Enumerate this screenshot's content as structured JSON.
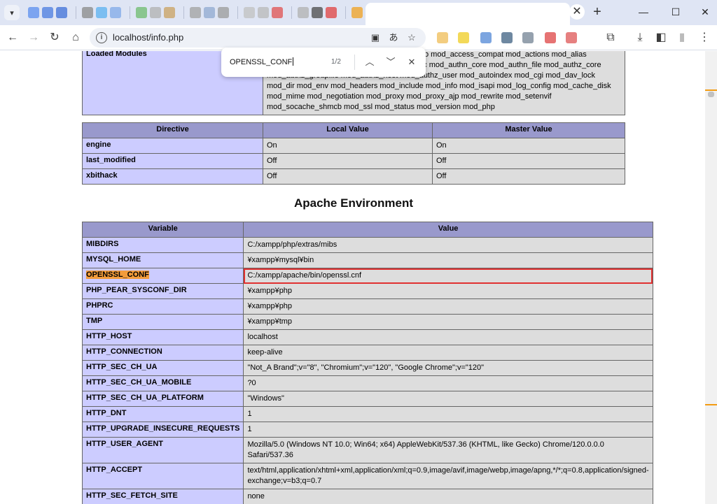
{
  "browser": {
    "tab_colors": [
      "#5b8def",
      "#4a7be0",
      "#3d6fd8",
      "#888888",
      "#5ab0f0",
      "#7fa8e8",
      "#6dbb6d",
      "#b0b0b0",
      "#c9a060",
      "#a0a0a0",
      "#8fa8d0",
      "#999999",
      "#c0c0c0",
      "#b8b8b8",
      "#e05050",
      "#b0b0b0",
      "#4a4a4a",
      "#e04040",
      "#f0a020",
      "#f0c030",
      "#e06060",
      "#e080a0",
      "#f0a0b0"
    ],
    "url": "localhost/info.php",
    "extension_colors": [
      "#f0c060",
      "#f0d030",
      "#5b8fd8",
      "#4a6a8a",
      "#7a8a9a",
      "#e05050",
      "#e06060"
    ]
  },
  "find": {
    "query": "OPENSSL_CONF",
    "count": "1/2"
  },
  "modules": {
    "label": "Loaded Modules",
    "lines": [
      "core mod_win32 mpm_winnt http_core mod_so mod_access_compat mod_actions mod_alias",
      "mod_allowmethods mod_asis mod_auth_basic mod_authn_core mod_authn_file mod_authz_core",
      "mod_authz_groupfile mod_authz_host mod_authz_user mod_autoindex mod_cgi mod_dav_lock",
      "mod_dir mod_env mod_headers mod_include mod_info mod_isapi mod_log_config mod_cache_disk",
      "mod_mime mod_negotiation mod_proxy mod_proxy_ajp mod_rewrite mod_setenvif",
      "mod_socache_shmcb mod_ssl mod_status mod_version mod_php"
    ]
  },
  "directives": {
    "headers": [
      "Directive",
      "Local Value",
      "Master Value"
    ],
    "rows": [
      {
        "name": "engine",
        "local": "On",
        "master": "On"
      },
      {
        "name": "last_modified",
        "local": "Off",
        "master": "Off"
      },
      {
        "name": "xbithack",
        "local": "Off",
        "master": "Off"
      }
    ]
  },
  "env_title": "Apache Environment",
  "env": {
    "headers": [
      "Variable",
      "Value"
    ],
    "rows": [
      {
        "name": "MIBDIRS",
        "value": "C:/xampp/php/extras/mibs"
      },
      {
        "name": "MYSQL_HOME",
        "value": "¥xampp¥mysql¥bin"
      },
      {
        "name": "OPENSSL_CONF",
        "value": "C:/xampp/apache/bin/openssl.cnf",
        "highlight": true
      },
      {
        "name": "PHP_PEAR_SYSCONF_DIR",
        "value": "¥xampp¥php"
      },
      {
        "name": "PHPRC",
        "value": "¥xampp¥php"
      },
      {
        "name": "TMP",
        "value": "¥xampp¥tmp"
      },
      {
        "name": "HTTP_HOST",
        "value": "localhost"
      },
      {
        "name": "HTTP_CONNECTION",
        "value": "keep-alive"
      },
      {
        "name": "HTTP_SEC_CH_UA",
        "value": "\"Not_A Brand\";v=\"8\", \"Chromium\";v=\"120\", \"Google Chrome\";v=\"120\""
      },
      {
        "name": "HTTP_SEC_CH_UA_MOBILE",
        "value": "?0"
      },
      {
        "name": "HTTP_SEC_CH_UA_PLATFORM",
        "value": "\"Windows\""
      },
      {
        "name": "HTTP_DNT",
        "value": "1"
      },
      {
        "name": "HTTP_UPGRADE_INSECURE_REQUESTS",
        "value": "1"
      },
      {
        "name": "HTTP_USER_AGENT",
        "value": "Mozilla/5.0 (Windows NT 10.0; Win64; x64) AppleWebKit/537.36 (KHTML, like Gecko) Chrome/120.0.0.0 Safari/537.36"
      },
      {
        "name": "HTTP_ACCEPT",
        "value": "text/html,application/xhtml+xml,application/xml;q=0.9,image/avif,image/webp,image/apng,*/*;q=0.8,application/signed-exchange;v=b3;q=0.7"
      },
      {
        "name": "HTTP_SEC_FETCH_SITE",
        "value": "none"
      }
    ]
  }
}
